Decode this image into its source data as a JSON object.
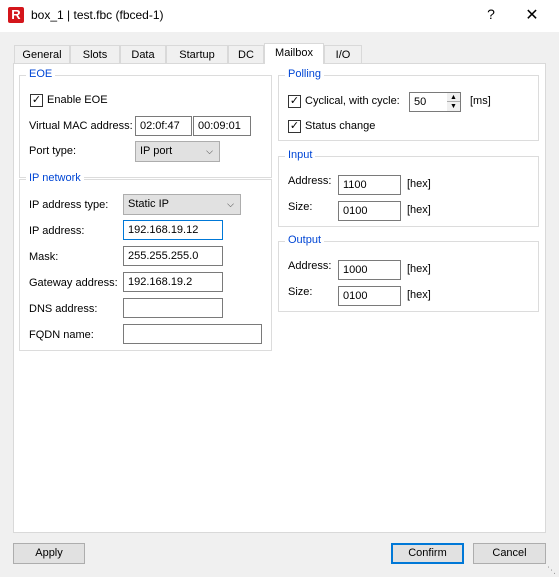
{
  "window": {
    "title": "box_1 | test.fbc (fbced-1)",
    "logo_letter": "R",
    "help": "?",
    "close": "✕"
  },
  "tabs": [
    {
      "label": "General"
    },
    {
      "label": "Slots"
    },
    {
      "label": "Data"
    },
    {
      "label": "Startup"
    },
    {
      "label": "DC"
    },
    {
      "label": "Mailbox"
    },
    {
      "label": "I/O"
    }
  ],
  "active_tab": "Mailbox",
  "eoe": {
    "title": "EOE",
    "enable_label": "Enable EOE",
    "enable_checked": true,
    "mac_label": "Virtual MAC address:",
    "mac_part1": "02:0f:47",
    "mac_part2": "00:09:01",
    "port_type_label": "Port type:",
    "port_type_value": "IP port"
  },
  "ip_network": {
    "title": "IP network",
    "addr_type_label": "IP address type:",
    "addr_type_value": "Static IP",
    "ip_label": "IP address:",
    "ip_value": "192.168.19.12",
    "mask_label": "Mask:",
    "mask_value": "255.255.255.0",
    "gateway_label": "Gateway address:",
    "gateway_value": "192.168.19.2",
    "dns_label": "DNS address:",
    "dns_value": "",
    "fqdn_label": "FQDN name:",
    "fqdn_value": ""
  },
  "polling": {
    "title": "Polling",
    "cyclical_label": "Cyclical, with cycle:",
    "cyclical_checked": true,
    "cycle_value": "50",
    "cycle_unit": "[ms]",
    "status_label": "Status change",
    "status_checked": true
  },
  "input": {
    "title": "Input",
    "address_label": "Address:",
    "address_value": "1100",
    "address_unit": "[hex]",
    "size_label": "Size:",
    "size_value": "0100",
    "size_unit": "[hex]"
  },
  "output": {
    "title": "Output",
    "address_label": "Address:",
    "address_value": "1000",
    "address_unit": "[hex]",
    "size_label": "Size:",
    "size_value": "0100",
    "size_unit": "[hex]"
  },
  "buttons": {
    "apply": "Apply",
    "confirm": "Confirm",
    "cancel": "Cancel"
  },
  "colors": {
    "group_title": "#0046d5",
    "focus_border": "#0078d7",
    "logo": "#d4151b"
  }
}
